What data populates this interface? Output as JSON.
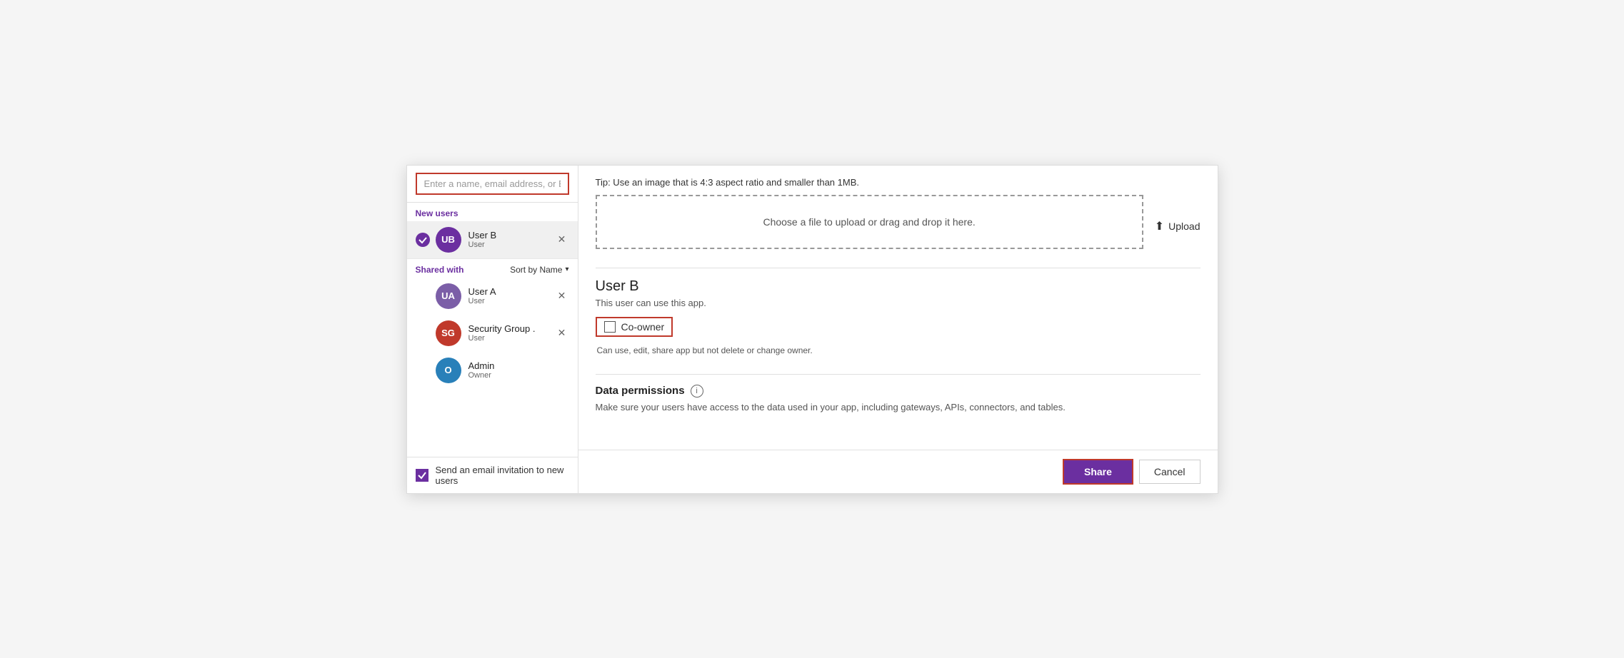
{
  "search": {
    "placeholder": "Enter a name, email address, or Everyone"
  },
  "new_users": {
    "label": "New users"
  },
  "new_user_list": [
    {
      "initials": "UB",
      "avatar_color": "#6b2fa0",
      "name": "User B",
      "role": "User",
      "selected": true
    }
  ],
  "shared_with": {
    "label": "Shared with",
    "sort_label": "Sort by Name"
  },
  "shared_users": [
    {
      "initials": "UA",
      "avatar_color": "#7b5ea7",
      "name": "User A",
      "role": "User"
    },
    {
      "initials": "SG",
      "avatar_color": "#c0392b",
      "name": "Security Group .",
      "role": "User"
    },
    {
      "initials": "O",
      "avatar_color": "#2980b9",
      "name": "Admin",
      "role": "Owner"
    }
  ],
  "send_email": {
    "label": "Send an email invitation to new users"
  },
  "right_panel": {
    "tip": "Tip: Use an image that is 4:3 aspect ratio and smaller than 1MB.",
    "upload_area_text": "Choose a file to upload or drag and drop it here.",
    "upload_btn_label": "Upload",
    "user_b_title": "User B",
    "user_b_desc": "This user can use this app.",
    "co_owner_label": "Co-owner",
    "co_owner_hint": "Can use, edit, share app but not delete or change owner.",
    "data_permissions_title": "Data permissions",
    "data_permissions_desc": "Make sure your users have access to the data used in your app, including gateways, APIs, connectors, and tables."
  },
  "buttons": {
    "share": "Share",
    "cancel": "Cancel"
  }
}
